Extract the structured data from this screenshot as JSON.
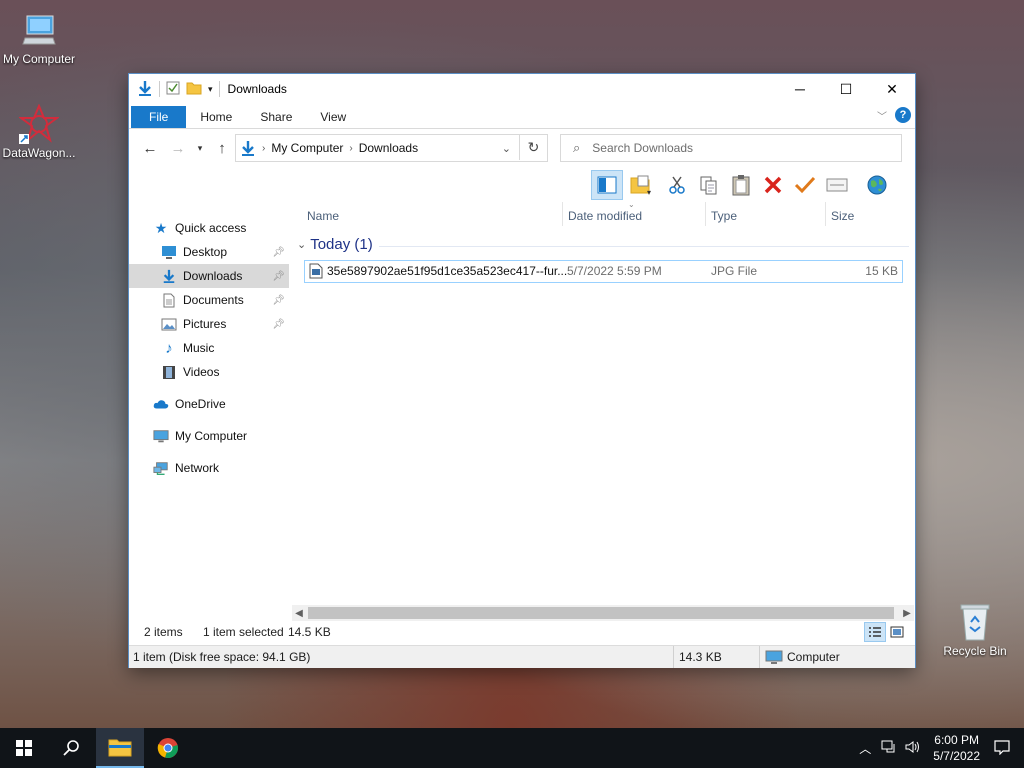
{
  "desktop": {
    "icons": [
      {
        "label": "My Computer"
      },
      {
        "label": "DataWagon..."
      },
      {
        "label": "Recycle Bin"
      }
    ]
  },
  "window": {
    "title": "Downloads",
    "ribbon_tabs": [
      "File",
      "Home",
      "Share",
      "View"
    ],
    "help_label": "?",
    "address": {
      "crumbs": [
        "My Computer",
        "Downloads"
      ]
    },
    "search": {
      "placeholder": "Search Downloads"
    },
    "nav_pane": {
      "quick_access": "Quick access",
      "items": [
        {
          "label": "Desktop",
          "pinned": true
        },
        {
          "label": "Downloads",
          "pinned": true,
          "selected": true
        },
        {
          "label": "Documents",
          "pinned": true
        },
        {
          "label": "Pictures",
          "pinned": true
        },
        {
          "label": "Music",
          "pinned": false
        },
        {
          "label": "Videos",
          "pinned": false
        }
      ],
      "onedrive": "OneDrive",
      "my_computer": "My Computer",
      "network": "Network"
    },
    "columns": {
      "name": "Name",
      "date": "Date modified",
      "type": "Type",
      "size": "Size"
    },
    "group_label": "Today (1)",
    "files": [
      {
        "name": "35e5897902ae51f95d1ce35a523ec417--fur...",
        "date": "5/7/2022 5:59 PM",
        "type": "JPG File",
        "size": "15 KB"
      }
    ],
    "status": {
      "items": "2 items",
      "selected": "1 item selected",
      "selected_size": "14.5 KB"
    },
    "statusbar": {
      "disk": "1 item (Disk free space: 94.1 GB)",
      "size": "14.3 KB",
      "location": "Computer"
    }
  },
  "taskbar": {
    "time": "6:00 PM",
    "date": "5/7/2022"
  },
  "colors": {
    "accent": "#1979ca",
    "taskbar": "#101418"
  }
}
